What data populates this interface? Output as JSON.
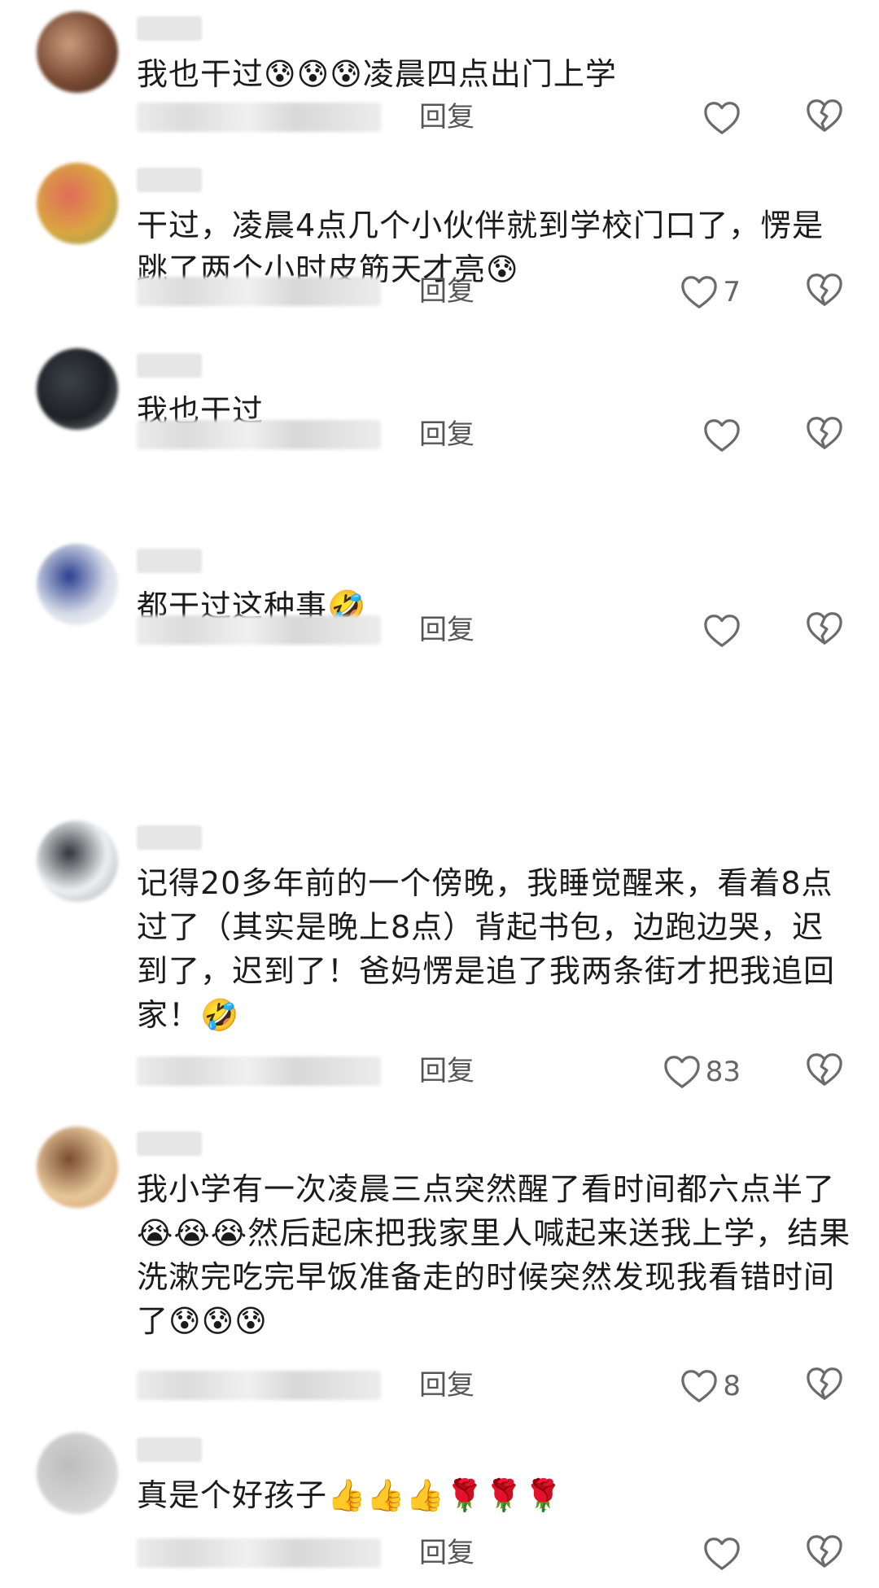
{
  "reply_label": "回复",
  "comments": [
    {
      "text": "我也干过😰😰😰凌晨四点出门上学",
      "likes": "",
      "avatar_colors": [
        "#7a4a33",
        "#c99b7d",
        "#3d2a22"
      ]
    },
    {
      "text": "干过，凌晨4点几个小伙伴就到学校门口了，愣是跳了两个小时皮筋天才亮😰",
      "likes": "7",
      "avatar_colors": [
        "#d9a640",
        "#e06b5a",
        "#8ba35c"
      ]
    },
    {
      "text": "我也干过",
      "likes": "",
      "avatar_colors": [
        "#1e2227",
        "#3c4148",
        "#8a8a8a"
      ]
    },
    {
      "text": "都干过这种事🤣",
      "likes": "",
      "avatar_colors": [
        "#d7dde8",
        "#2a3e8f",
        "#ffffff"
      ]
    },
    {
      "text": "记得20多年前的一个傍晚，我睡觉醒来，看着8点过了（其实是晚上8点）背起书包，边跑边哭，迟到了，迟到了！爸妈愣是追了我两条街才把我追回家！🤣",
      "likes": "83",
      "avatar_colors": [
        "#eef0f2",
        "#30343a",
        "#9aa0a8"
      ]
    },
    {
      "text": "我小学有一次凌晨三点突然醒了看时间都六点半了😭😭😭然后起床把我家里人喊起来送我上学，结果洗漱完吃完早饭准备走的时候突然发现我看错时间了😰😰😰",
      "likes": "8",
      "avatar_colors": [
        "#e7c79a",
        "#7a4b2e",
        "#d49a6a"
      ]
    },
    {
      "text": "真是个好孩子👍👍👍🌹🌹🌹",
      "likes": "",
      "avatar_colors": [
        "#d2d2d2",
        "#bdbdbd",
        "#e6e6e6"
      ]
    }
  ]
}
